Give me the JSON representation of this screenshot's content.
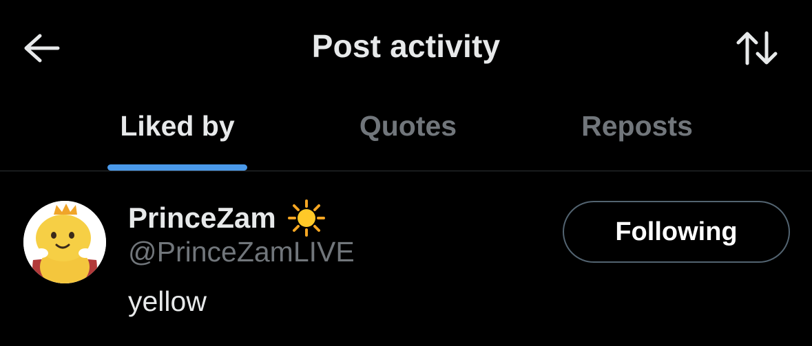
{
  "header": {
    "title": "Post activity",
    "back_icon": "arrow-left-icon",
    "sort_icon": "sort-arrows-icon"
  },
  "tabs": [
    {
      "label": "Liked by",
      "active": true
    },
    {
      "label": "Quotes",
      "active": false
    },
    {
      "label": "Reposts",
      "active": false
    }
  ],
  "colors": {
    "background": "#000000",
    "accent": "#4a99e9",
    "text_primary": "#e7e9ea",
    "text_secondary": "#71767b",
    "divider": "#2f3336"
  },
  "users": [
    {
      "display_name": "PrinceZam",
      "badge_icon": "sun-icon",
      "handle": "@PrinceZamLIVE",
      "bio": "yellow",
      "follow_label": "Following",
      "avatar_icon": "yellow-character-avatar"
    }
  ]
}
